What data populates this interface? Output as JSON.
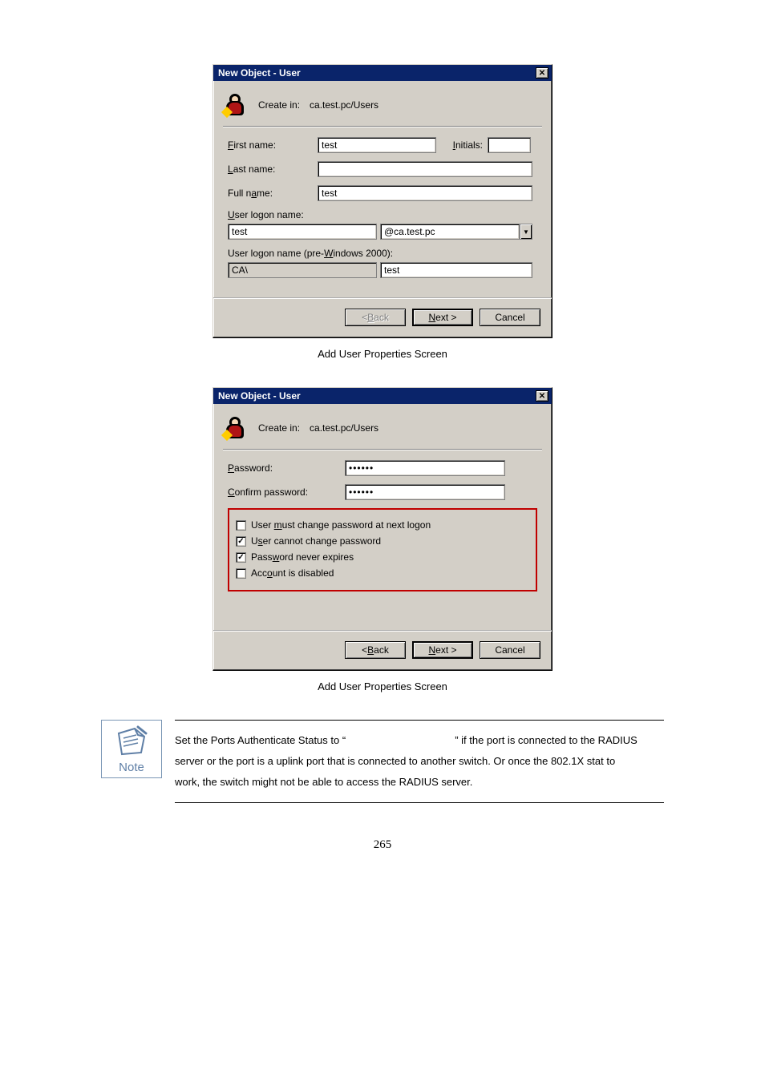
{
  "dialog1": {
    "title": "New Object - User",
    "create_in_label": "Create in:",
    "create_in_path": "ca.test.pc/Users",
    "first_name_label_pre": "F",
    "first_name_label_post": "irst name:",
    "first_name_value": "test",
    "initials_label_pre": "I",
    "initials_label_post": "nitials:",
    "initials_value": "",
    "last_name_label_pre": "L",
    "last_name_label_post": "ast name:",
    "last_name_value": "",
    "full_name_label_pre": "Full n",
    "full_name_label_u": "a",
    "full_name_label_post": "me:",
    "full_name_value": "test",
    "logon_label_pre": "U",
    "logon_label_post": "ser logon name:",
    "logon_value": "test",
    "logon_domain": "@ca.test.pc",
    "prewin_label_pre": "User logon name (pre-",
    "prewin_label_u": "W",
    "prewin_label_post": "indows 2000):",
    "prewin_domain": "CA\\",
    "prewin_value": "test",
    "back_label_pre": "< ",
    "back_u": "B",
    "back_post": "ack",
    "next_u": "N",
    "next_post": "ext >",
    "cancel": "Cancel"
  },
  "caption1": "Add User Properties Screen",
  "dialog2": {
    "title": "New Object - User",
    "create_in_label": "Create in:",
    "create_in_path": "ca.test.pc/Users",
    "password_label_pre": "P",
    "password_label_post": "assword:",
    "password_value": "••••••",
    "confirm_label_pre": "C",
    "confirm_label_post": "onfirm password:",
    "confirm_value": "••••••",
    "opt1_checked": false,
    "opt1_pre": "User ",
    "opt1_u": "m",
    "opt1_post": "ust change password at next logon",
    "opt2_checked": true,
    "opt2_pre": "U",
    "opt2_u": "s",
    "opt2_post": "er cannot change password",
    "opt3_checked": true,
    "opt3_pre": "Pass",
    "opt3_u": "w",
    "opt3_post": "ord never expires",
    "opt4_checked": false,
    "opt4_pre": "Acc",
    "opt4_u": "o",
    "opt4_post": "unt is disabled"
  },
  "caption2": "Add User Properties Screen",
  "note": {
    "icon_label": "Note",
    "line1a": "Set the Ports Authenticate Status to “",
    "line1b": "” if the port is connected to the RADIUS",
    "line2": "server or the port is a uplink port that is connected to another switch. Or once the 802.1X stat to",
    "line3": "work, the switch might not be able to access the RADIUS server."
  },
  "page_number": "265"
}
